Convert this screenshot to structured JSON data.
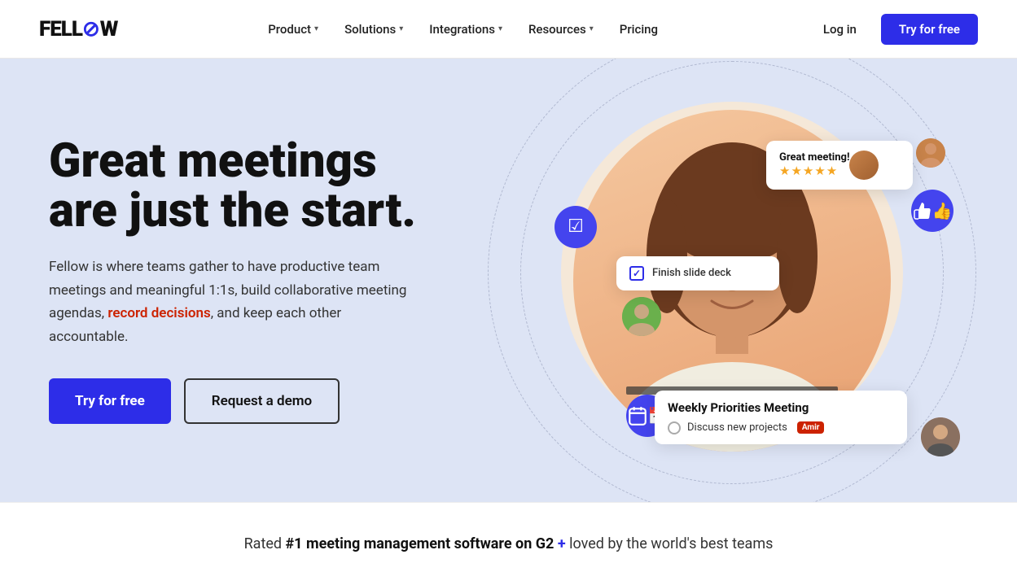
{
  "logo": {
    "text_before": "FELL",
    "icon": "⊘",
    "text_after": "W"
  },
  "nav": {
    "links": [
      {
        "label": "Product",
        "has_dropdown": true
      },
      {
        "label": "Solutions",
        "has_dropdown": true
      },
      {
        "label": "Integrations",
        "has_dropdown": true
      },
      {
        "label": "Resources",
        "has_dropdown": true
      },
      {
        "label": "Pricing",
        "has_dropdown": false
      }
    ],
    "login_label": "Log in",
    "cta_label": "Try for free"
  },
  "hero": {
    "title": "Great meetings are just the start.",
    "description_parts": [
      "Fellow is where teams gather to have productive team meetings and meaningful 1:1s, build collaborative meeting agendas, ",
      "record decisions",
      ", and keep each other accountable."
    ],
    "cta_primary": "Try for free",
    "cta_secondary": "Request a demo"
  },
  "ui_cards": {
    "rating": {
      "title": "Great meeting!",
      "stars": "★★★★★"
    },
    "task": {
      "label": "Finish slide deck"
    },
    "meeting": {
      "title": "Weekly Priorities Meeting",
      "item": "Discuss new projects",
      "badge": "Amir"
    }
  },
  "bottom": {
    "text": "Rated #1 meeting management software on G2 + loved by the world's best teams"
  }
}
